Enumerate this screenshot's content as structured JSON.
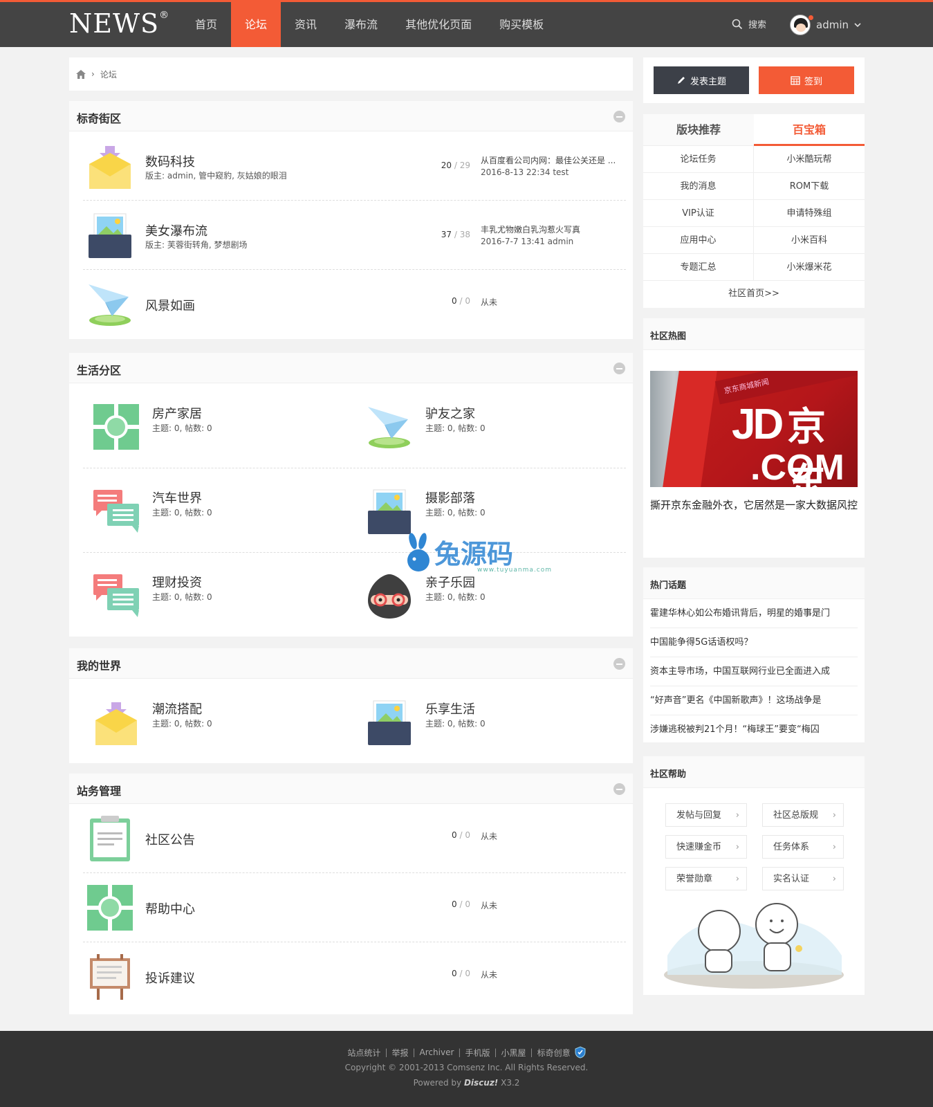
{
  "header": {
    "logo": "NEWS",
    "logo_mark": "®",
    "nav": [
      "首页",
      "论坛",
      "资讯",
      "瀑布流",
      "其他优化页面",
      "购买模板"
    ],
    "active_index": 1,
    "search_label": "搜索",
    "username": "admin",
    "accent_color": "#f35b36",
    "bar_color": "#444444"
  },
  "breadcrumb": {
    "current": "论坛"
  },
  "sections": {
    "s1": {
      "title": "标奇街区",
      "forums": [
        {
          "name": "数码科技",
          "mods": "版主: admin, 管中窥豹, 灰姑娘的眼泪",
          "threads": "20",
          "slash": " / ",
          "posts": "29",
          "last_title": "从百度看公司内网：最佳公关还是 ...",
          "last_meta": "2016-8-13 22:34 test",
          "icon": "envelope-icon"
        },
        {
          "name": "美女瀑布流",
          "mods": "版主: 芙蓉街转角, 梦想剧场",
          "threads": "37",
          "slash": " / ",
          "posts": "38",
          "last_title": "丰乳尤物嫩白乳沟惹火写真",
          "last_meta": "2016-7-7 13:41 admin",
          "icon": "photo-icon"
        },
        {
          "name": "风景如画",
          "threads": "0",
          "slash": " / ",
          "posts": "0",
          "last_title": "从未",
          "icon": "paper-plane-icon"
        }
      ]
    },
    "s2": {
      "title": "生活分区",
      "forums": [
        {
          "name": "房产家居",
          "stat": "主题: 0, 帖数: 0",
          "icon": "puzzle-icon"
        },
        {
          "name": "驴友之家",
          "stat": "主题: 0, 帖数: 0",
          "icon": "paper-plane-icon"
        },
        {
          "name": "汽车世界",
          "stat": "主题: 0, 帖数: 0",
          "icon": "chat-icon"
        },
        {
          "name": "摄影部落",
          "stat": "主题: 0, 帖数: 0",
          "icon": "photo-icon"
        },
        {
          "name": "理财投资",
          "stat": "主题: 0, 帖数: 0",
          "icon": "chat-icon"
        },
        {
          "name": "亲子乐园",
          "stat": "主题: 0, 帖数: 0",
          "icon": "ninja-icon"
        }
      ]
    },
    "s3": {
      "title": "我的世界",
      "forums": [
        {
          "name": "潮流搭配",
          "stat": "主题: 0, 帖数: 0",
          "icon": "envelope-icon"
        },
        {
          "name": "乐享生活",
          "stat": "主题: 0, 帖数: 0",
          "icon": "photo-icon"
        }
      ]
    },
    "s4": {
      "title": "站务管理",
      "forums": [
        {
          "name": "社区公告",
          "threads": "0",
          "slash": " / ",
          "posts": "0",
          "last_title": "从未",
          "icon": "clipboard-icon"
        },
        {
          "name": "帮助中心",
          "threads": "0",
          "slash": " / ",
          "posts": "0",
          "last_title": "从未",
          "icon": "puzzle-icon"
        },
        {
          "name": "投诉建议",
          "threads": "0",
          "slash": " / ",
          "posts": "0",
          "last_title": "从未",
          "icon": "easel-icon"
        }
      ]
    }
  },
  "watermark": {
    "text": "兔源码",
    "url": "www.tuyuanma.com"
  },
  "sidebar": {
    "post_button": "发表主题",
    "sign_button": "签到",
    "rec_tabs": [
      "版块推荐",
      "百宝箱"
    ],
    "rec_items": [
      [
        "论坛任务",
        "小米酷玩帮"
      ],
      [
        "我的消息",
        "ROM下载"
      ],
      [
        "VIP认证",
        "申请特殊组"
      ],
      [
        "应用中心",
        "小米百科"
      ],
      [
        "专题汇总",
        "小米爆米花"
      ]
    ],
    "rec_more": "社区首页>>",
    "hot_pic_title": "社区热图",
    "hot_pic": {
      "jd": "JD",
      "cn": "京东",
      "com": ".COM",
      "banner": "京东商城新闻",
      "caption": "撕开京东金融外衣，它居然是一家大数据风控"
    },
    "hot_topics_title": "热门话题",
    "hot_topics": [
      "霍建华林心如公布婚讯背后，明星的婚事是门",
      "中国能争得5G话语权吗？",
      "资本主导市场，中国互联网行业已全面进入成",
      "“好声音”更名《中国新歌声》！这场战争是",
      "涉嫌逃税被判21个月！“梅球王”要变“梅囚"
    ],
    "help_title": "社区帮助",
    "help_items": [
      "发帖与回复",
      "社区总版规",
      "快速赚金币",
      "任务体系",
      "荣誉勋章",
      "实名认证"
    ]
  },
  "footer": {
    "links": [
      "站点统计",
      "举报",
      "Archiver",
      "手机版",
      "小黑屋",
      "标奇创意"
    ],
    "copyright": "Copyright © 2001-2013 Comsenz Inc.   All Rights Reserved.",
    "powered_prefix": "Powered by ",
    "powered_brand": "Discuz!",
    "powered_version": " X3.2"
  }
}
